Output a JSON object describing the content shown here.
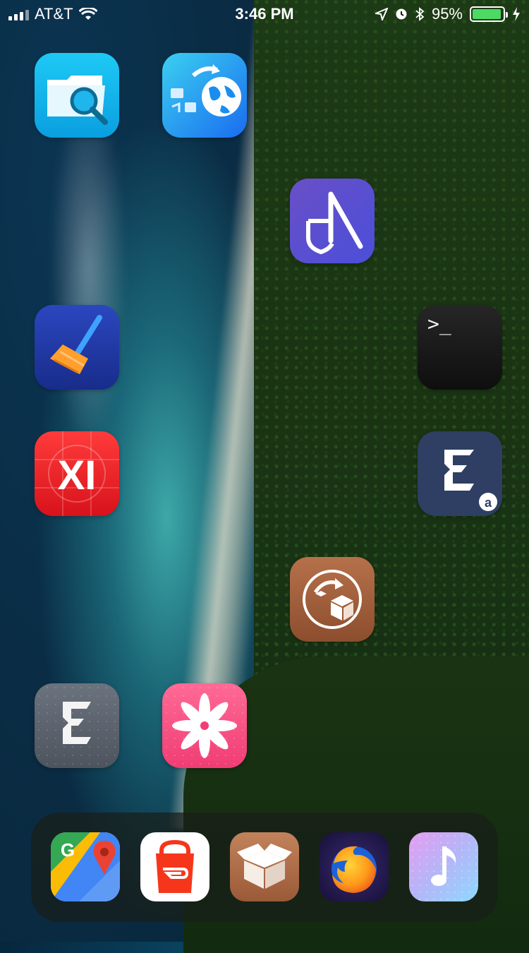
{
  "status_bar": {
    "carrier": "AT&T",
    "time": "3:46 PM",
    "battery_percent": "95%",
    "battery_level": 0.95
  },
  "home_screen": {
    "apps": [
      {
        "id": "filza",
        "icon": "folder-search-icon"
      },
      {
        "id": "globe-transfer",
        "icon": "globe-transfer-icon"
      },
      {
        "id": "arrow-shield",
        "icon": "shield-arrow-icon"
      },
      {
        "id": "cleaner",
        "icon": "broom-icon"
      },
      {
        "id": "terminal",
        "icon": "terminal-icon",
        "glyph": ">_"
      },
      {
        "id": "xi",
        "icon": "xi-logo-icon",
        "glyph": "XI"
      },
      {
        "id": "electra-at",
        "icon": "electra-at-icon",
        "badge": "a"
      },
      {
        "id": "cydia-installer",
        "icon": "package-arrow-icon"
      },
      {
        "id": "electra",
        "icon": "electra-e-icon"
      },
      {
        "id": "flower",
        "icon": "flower-icon"
      }
    ]
  },
  "dock": {
    "apps": [
      {
        "id": "google-maps",
        "icon": "maps-pin-icon",
        "glyph": "G"
      },
      {
        "id": "doordash",
        "icon": "shopping-bag-icon"
      },
      {
        "id": "cydia",
        "icon": "box-icon"
      },
      {
        "id": "firefox",
        "icon": "firefox-icon"
      },
      {
        "id": "music",
        "icon": "music-note-icon"
      }
    ]
  }
}
